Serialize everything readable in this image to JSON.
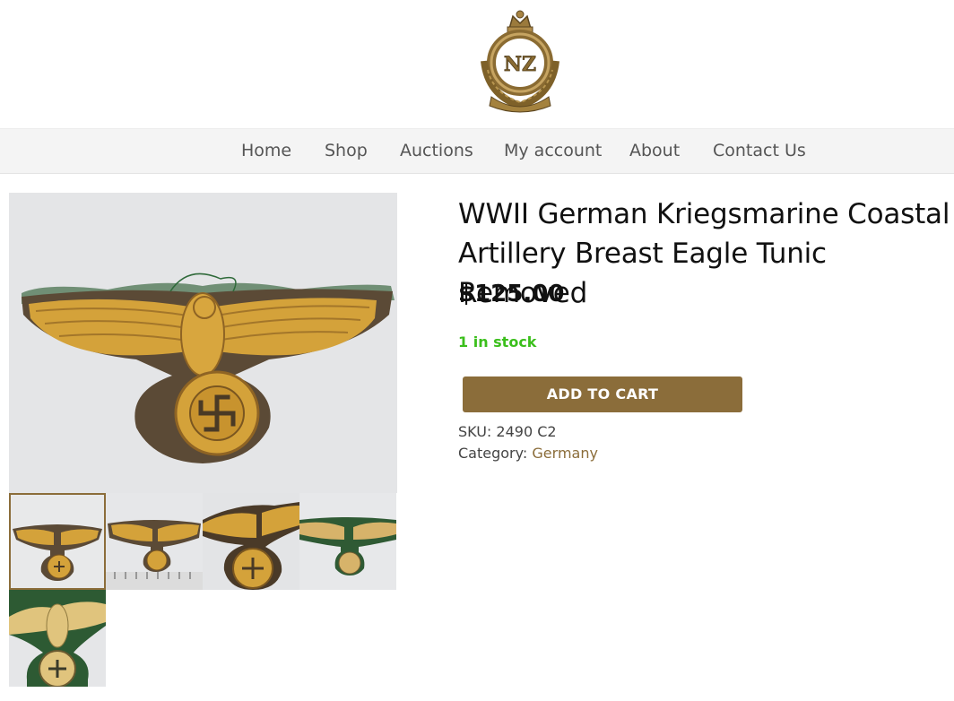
{
  "site": {
    "logo_text": "NZ"
  },
  "nav": {
    "items": [
      {
        "label": "Home"
      },
      {
        "label": "Shop"
      },
      {
        "label": "Auctions"
      },
      {
        "label": "My account"
      },
      {
        "label": "About"
      },
      {
        "label": "Contact Us"
      }
    ]
  },
  "product": {
    "title_line1": "WWII German Kriegsmarine Coastal",
    "title_line2": "Artillery Breast Eagle Tunic Removed",
    "price": "$125.00",
    "stock": "1 in stock",
    "add_to_cart": "ADD TO CART",
    "sku_label": "SKU:",
    "sku_value": "2490 C2",
    "category_label": "Category:",
    "category_value": "Germany"
  },
  "colors": {
    "accent": "#8b6d3a",
    "stock_green": "#3bbf1c",
    "nav_bg": "#f4f4f4"
  }
}
